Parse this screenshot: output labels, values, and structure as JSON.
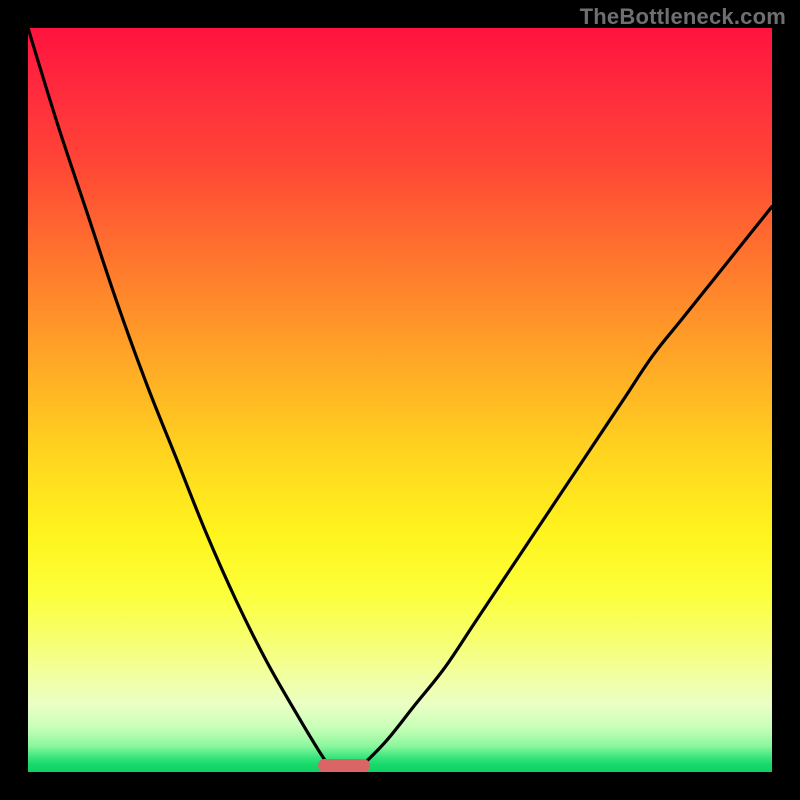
{
  "watermark": "TheBottleneck.com",
  "chart_data": {
    "type": "line",
    "title": "",
    "xlabel": "",
    "ylabel": "",
    "xlim": [
      0,
      100
    ],
    "ylim": [
      0,
      100
    ],
    "grid": false,
    "legend": false,
    "gradient_colors": {
      "top": "#ff133d",
      "mid_upper": "#ff8f2a",
      "mid": "#fff41e",
      "mid_lower": "#f2ffa0",
      "bottom": "#17d86a"
    },
    "series": [
      {
        "name": "left-curve",
        "x": [
          0,
          4,
          8,
          12,
          16,
          20,
          24,
          28,
          32,
          36,
          39,
          41
        ],
        "y": [
          100,
          87,
          75,
          63,
          52,
          42,
          32,
          23,
          15,
          8,
          3,
          0
        ]
      },
      {
        "name": "right-curve",
        "x": [
          44,
          48,
          52,
          56,
          60,
          64,
          68,
          72,
          76,
          80,
          84,
          88,
          92,
          96,
          100
        ],
        "y": [
          0,
          4,
          9,
          14,
          20,
          26,
          32,
          38,
          44,
          50,
          56,
          61,
          66,
          71,
          76
        ]
      }
    ],
    "marker": {
      "name": "bottleneck-pill",
      "x_start": 39,
      "x_end": 46,
      "y": 0,
      "color": "#d96565"
    }
  }
}
